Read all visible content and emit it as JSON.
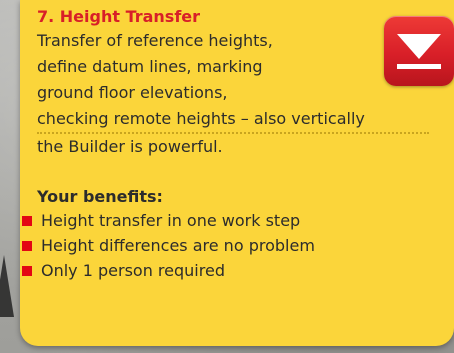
{
  "card": {
    "title": "7. Height Transfer",
    "description_lines": [
      "Transfer of reference heights,",
      "define datum lines, marking",
      "ground floor elevations,",
      "checking remote heights –  also vertically",
      "the Builder is powerful."
    ],
    "benefits_title": "Your benefits:",
    "benefits": [
      "Height transfer in one work step",
      "Height differences are no problem",
      "Only 1 person required"
    ],
    "toggle_icon": "collapse-arrow-down-icon"
  },
  "colors": {
    "card_background": "#fbd53a",
    "accent_red": "#d81f28",
    "bullet_red": "#e30613",
    "text": "#2c2c2c"
  }
}
